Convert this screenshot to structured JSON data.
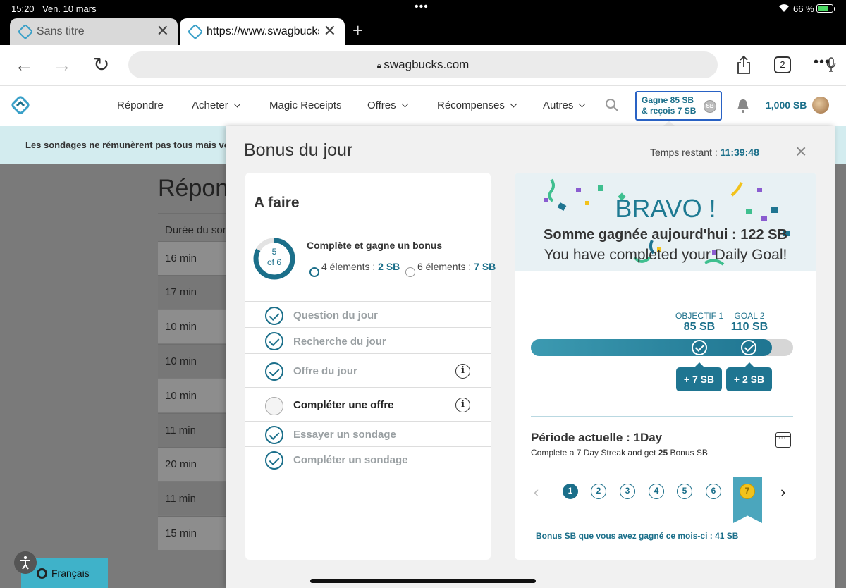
{
  "status_bar": {
    "time": "15:20",
    "date": "Ven. 10 mars",
    "battery": "66 %"
  },
  "tabs": [
    {
      "title": "Sans titre"
    },
    {
      "title": "https://www.swagbucks.com"
    }
  ],
  "address_bar": {
    "url": "swagbucks.com",
    "tab_count": "2"
  },
  "site_nav": {
    "items": [
      {
        "label": "Répondre"
      },
      {
        "label": "Acheter"
      },
      {
        "label": "Magic Receipts"
      },
      {
        "label": "Offres"
      },
      {
        "label": "Récompenses"
      },
      {
        "label": "Autres"
      }
    ],
    "gagne_line1": "Gagne 85 SB",
    "gagne_line2": "& reçois 7 SB",
    "sb_badge": "SB",
    "balance": "1,000 SB"
  },
  "background_page": {
    "banner": "Les sondages ne rémunèrent pas tous mais voici ceux qui le font",
    "title": "Réponses",
    "column_header": "Durée du sondage",
    "rows": [
      "16 min",
      "17 min",
      "10 min",
      "10 min",
      "10 min",
      "11 min",
      "20 min",
      "11 min",
      "15 min"
    ]
  },
  "language": {
    "label": "Français"
  },
  "modal": {
    "title": "Bonus du jour",
    "timer_label": "Temps restant :",
    "timer_value": "11:39:48",
    "close": "×",
    "todo": {
      "heading": "A faire",
      "progress_num": "5",
      "progress_of": "of 6",
      "progress_fraction": 0.83,
      "goal_heading": "Complète et gagne un bonus",
      "option1_text": "4 élements :",
      "option1_value": "2 SB",
      "option2_text": "6 élements :",
      "option2_value": "7 SB",
      "tasks": [
        {
          "label": "Question du jour",
          "done": true
        },
        {
          "label": "Recherche du jour",
          "done": true
        },
        {
          "label": "Offre du jour",
          "done": true
        },
        {
          "label": "Compléter une offre",
          "done": false
        },
        {
          "label": "Essayer un sondage",
          "done": true
        },
        {
          "label": "Compléter un sondage",
          "done": true
        }
      ],
      "info_icon": "i"
    },
    "bravo": {
      "title": "BRAVO !",
      "somme": "Somme gagnée aujourd'hui : 122 SB",
      "completed": "You have completed your Daily Goal!",
      "goal1_label": "OBJECTIF 1",
      "goal1_value": "85 SB",
      "goal2_label": "GOAL 2",
      "goal2_value": "110 SB",
      "progress_fraction": 0.92,
      "bonus1": "+ 7 SB",
      "bonus2": "+ 2 SB",
      "periode": "Période actuelle : 1Day",
      "streak_pre": "Complete a 7 Day Streak and get ",
      "streak_num": "25",
      "streak_post": " Bonus SB",
      "days": [
        "1",
        "2",
        "3",
        "4",
        "5",
        "6",
        "7"
      ],
      "monthly_label": "Bonus SB que vous avez gagné ce mois-ci :",
      "monthly_value": "41 SB"
    }
  }
}
